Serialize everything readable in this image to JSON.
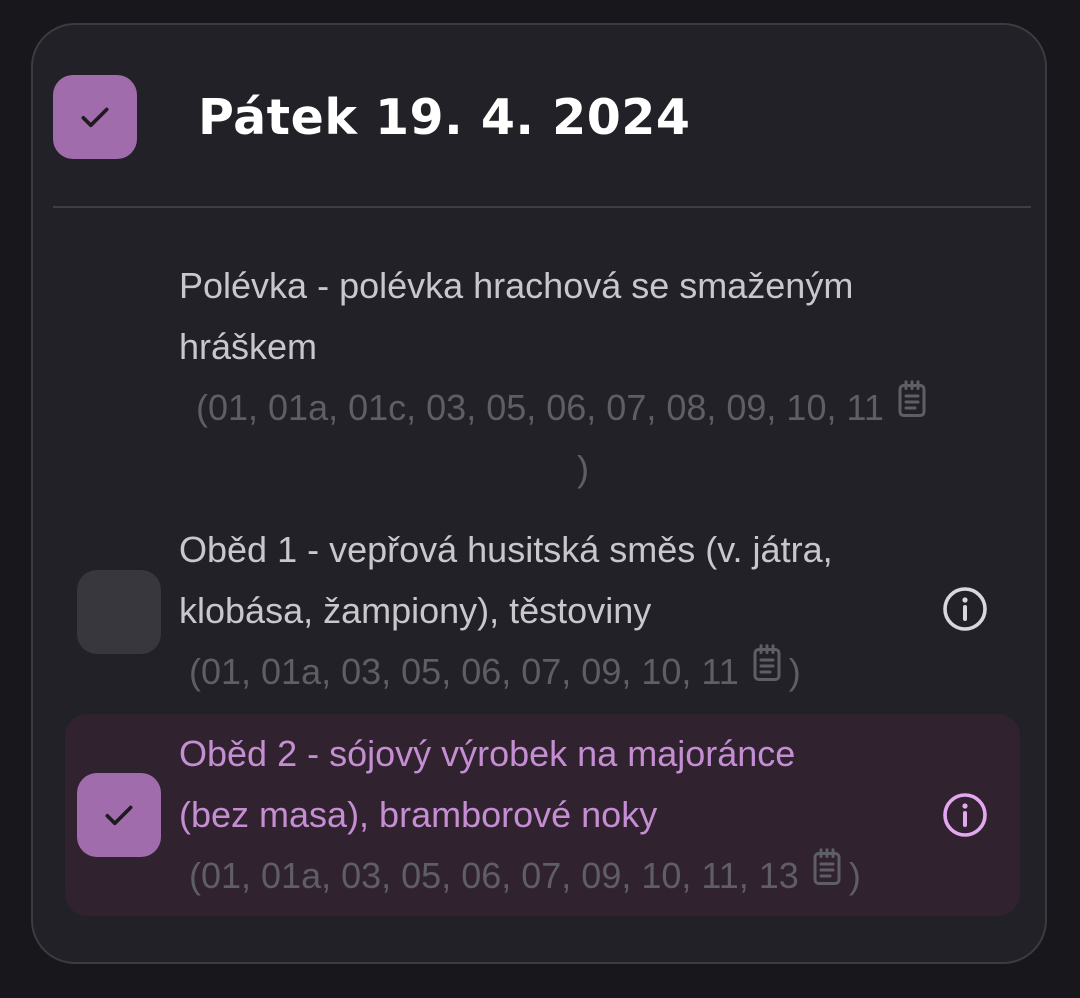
{
  "day": {
    "title": "Pátek 19. 4. 2024",
    "checked": true,
    "check_icon": "check-icon"
  },
  "meals": [
    {
      "name_lines": [
        "Polévka - polévka hrachová se smaženým",
        "hráškem"
      ],
      "allergens_line1": "(01, 01a, 01c, 03, 05, 06, 07, 08, 09, 10, 11",
      "allergens_line2": ")",
      "has_checkbox": false,
      "has_info": false
    },
    {
      "name_lines": [
        "Oběd 1 - vepřová husitská směs (v. játra,",
        "klobása, žampiony), těstoviny"
      ],
      "allergens_line1": "(01, 01a, 03, 05, 06, 07, 09, 10, 11",
      "allergens_close": ")",
      "has_checkbox": true,
      "checked": false,
      "has_info": true
    },
    {
      "name_lines": [
        "Oběd 2 - sójový výrobek na majoránce",
        "(bez masa), bramborové noky"
      ],
      "allergens_line1": "(01, 01a, 03, 05, 06, 07, 09, 10, 11, 13",
      "allergens_close": ")",
      "has_checkbox": true,
      "checked": true,
      "has_info": true
    }
  ],
  "colors": {
    "accent": "#a06cab",
    "selected_row_bg": "#30222f",
    "selected_text": "#c58ed2",
    "text": "#c8c8cc",
    "allergen_text": "#5e5e64",
    "card_bg": "#212127",
    "page_bg": "#18181c"
  },
  "icons": {
    "allergen_list": "notebook-icon",
    "info": "info-icon",
    "check": "check-icon"
  }
}
